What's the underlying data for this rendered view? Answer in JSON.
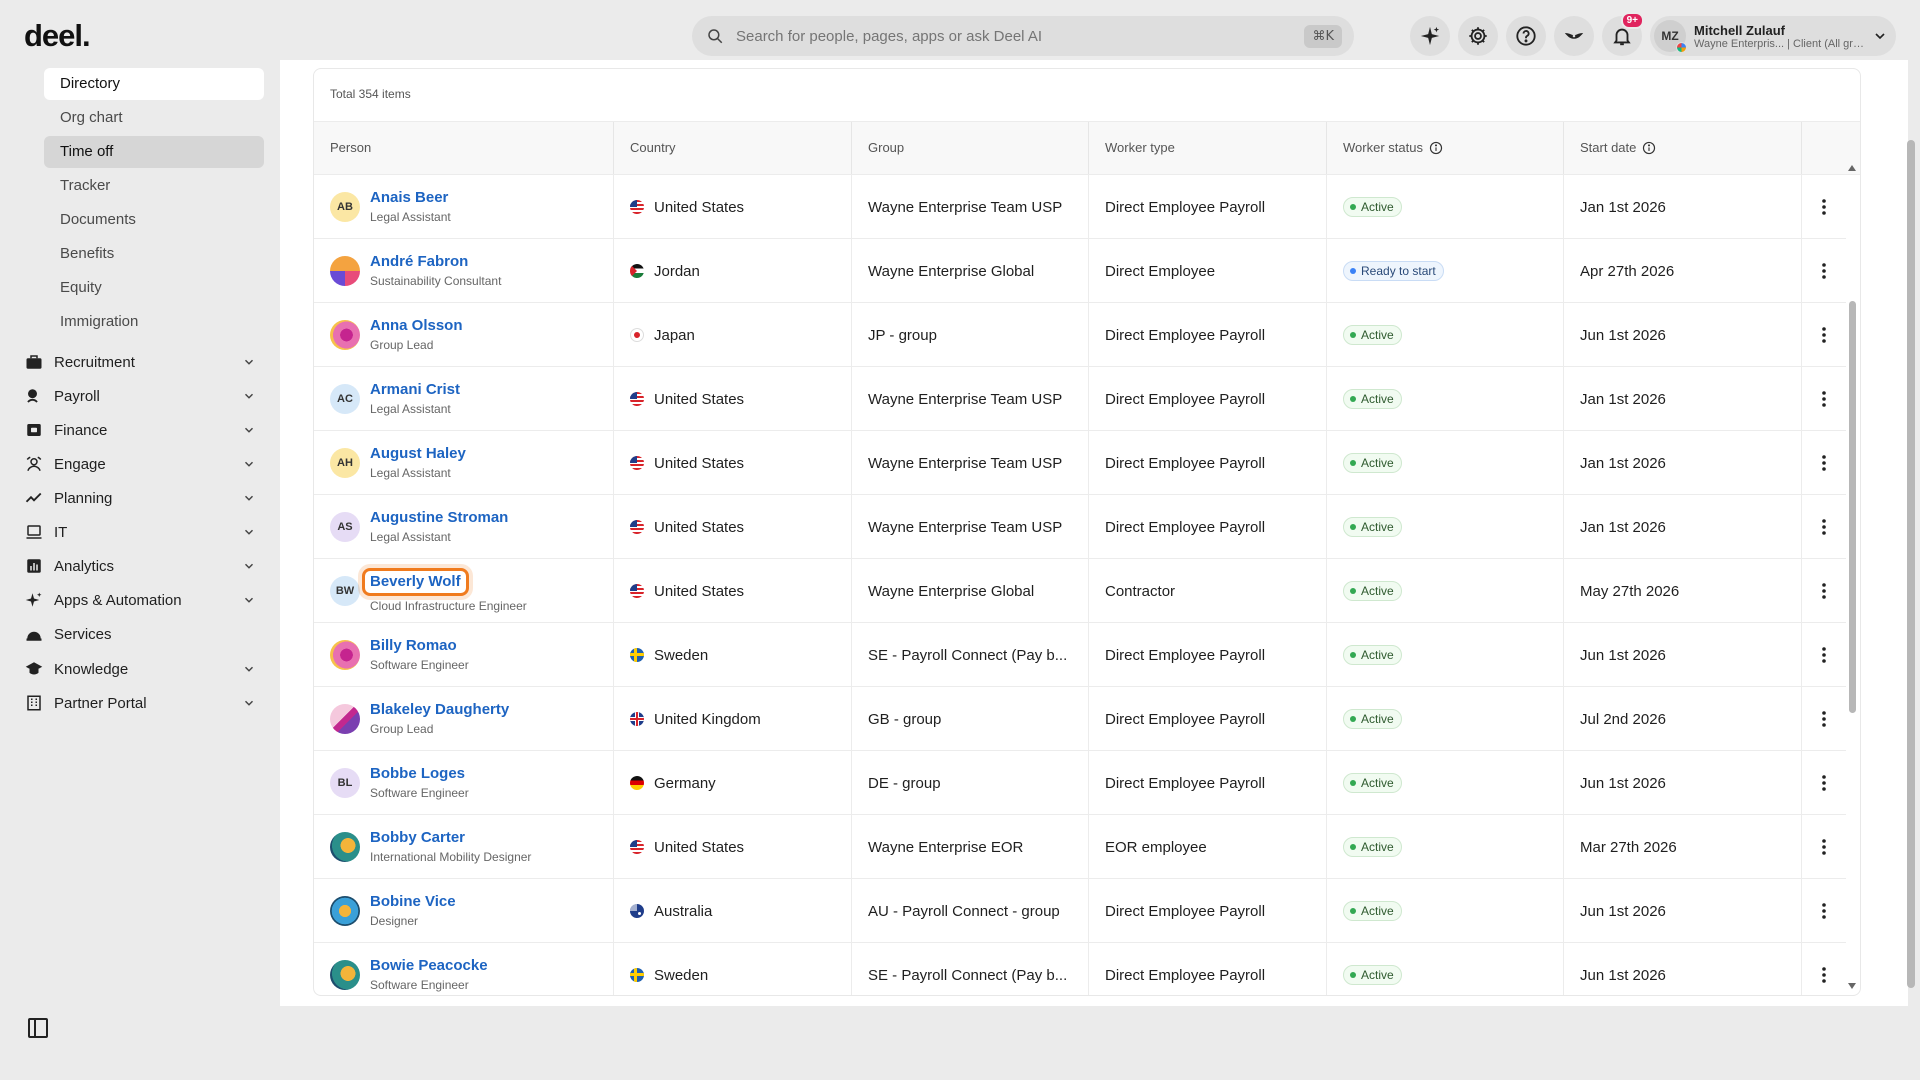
{
  "header": {
    "logo": "deel.",
    "search_placeholder": "Search for people, pages, apps or ask Deel AI",
    "search_shortcut": "⌘K",
    "notification_count": "9+",
    "user": {
      "initials": "MZ",
      "name": "Mitchell Zulauf",
      "subtitle": "Wayne Enterpris... | Client (All gro..."
    }
  },
  "sidebar": {
    "sub_items": [
      "Directory",
      "Org chart",
      "Time off",
      "Tracker",
      "Documents",
      "Benefits",
      "Equity",
      "Immigration"
    ],
    "nav_items": [
      {
        "label": "Recruitment",
        "icon": "briefcase-icon",
        "chevron": true
      },
      {
        "label": "Payroll",
        "icon": "payroll-icon",
        "chevron": true
      },
      {
        "label": "Finance",
        "icon": "finance-icon",
        "chevron": true
      },
      {
        "label": "Engage",
        "icon": "engage-icon",
        "chevron": true
      },
      {
        "label": "Planning",
        "icon": "trend-icon",
        "chevron": true
      },
      {
        "label": "IT",
        "icon": "laptop-icon",
        "chevron": true
      },
      {
        "label": "Analytics",
        "icon": "chart-icon",
        "chevron": true
      },
      {
        "label": "Apps & Automation",
        "icon": "sparkle-icon",
        "chevron": true
      },
      {
        "label": "Services",
        "icon": "services-icon",
        "chevron": false
      },
      {
        "label": "Knowledge",
        "icon": "graduation-icon",
        "chevron": true
      },
      {
        "label": "Partner Portal",
        "icon": "building-icon",
        "chevron": true
      }
    ]
  },
  "table": {
    "total": "Total 354 items",
    "columns": [
      "Person",
      "Country",
      "Group",
      "Worker type",
      "Worker status",
      "Start date"
    ],
    "rows": [
      {
        "name": "Anais Beer",
        "title": "Legal Assistant",
        "initials": "AB",
        "avatar": "#fbe7a4",
        "country": "United States",
        "flag": "us",
        "group": "Wayne Enterprise Team USP",
        "worker_type": "Direct Employee Payroll",
        "status": "Active",
        "start": "Jan 1st 2026"
      },
      {
        "name": "André Fabron",
        "title": "Sustainability Consultant",
        "initials": "",
        "avatar": "art1",
        "country": "Jordan",
        "flag": "jo",
        "group": "Wayne Enterprise Global",
        "worker_type": "Direct Employee",
        "status": "Ready to start",
        "start": "Apr 27th 2026"
      },
      {
        "name": "Anna Olsson",
        "title": "Group Lead",
        "initials": "",
        "avatar": "art2",
        "country": "Japan",
        "flag": "jp",
        "group": "JP - group",
        "worker_type": "Direct Employee Payroll",
        "status": "Active",
        "start": "Jun 1st 2026"
      },
      {
        "name": "Armani Crist",
        "title": "Legal Assistant",
        "initials": "AC",
        "avatar": "#d6e8f8",
        "country": "United States",
        "flag": "us",
        "group": "Wayne Enterprise Team USP",
        "worker_type": "Direct Employee Payroll",
        "status": "Active",
        "start": "Jan 1st 2026"
      },
      {
        "name": "August Haley",
        "title": "Legal Assistant",
        "initials": "AH",
        "avatar": "#fbe7a4",
        "country": "United States",
        "flag": "us",
        "group": "Wayne Enterprise Team USP",
        "worker_type": "Direct Employee Payroll",
        "status": "Active",
        "start": "Jan 1st 2026"
      },
      {
        "name": "Augustine Stroman",
        "title": "Legal Assistant",
        "initials": "AS",
        "avatar": "#e6dcf5",
        "country": "United States",
        "flag": "us",
        "group": "Wayne Enterprise Team USP",
        "worker_type": "Direct Employee Payroll",
        "status": "Active",
        "start": "Jan 1st 2026"
      },
      {
        "name": "Beverly Wolf",
        "title": "Cloud Infrastructure Engineer",
        "initials": "BW",
        "avatar": "#d6e8f8",
        "country": "United States",
        "flag": "us",
        "group": "Wayne Enterprise Global",
        "worker_type": "Contractor",
        "status": "Active",
        "start": "May 27th 2026",
        "focused": true
      },
      {
        "name": "Billy Romao",
        "title": "Software Engineer",
        "initials": "",
        "avatar": "art2",
        "country": "Sweden",
        "flag": "se",
        "group": "SE - Payroll Connect (Pay b...",
        "worker_type": "Direct Employee Payroll",
        "status": "Active",
        "start": "Jun 1st 2026"
      },
      {
        "name": "Blakeley Daugherty",
        "title": "Group Lead",
        "initials": "",
        "avatar": "art3",
        "country": "United Kingdom",
        "flag": "gb",
        "group": "GB - group",
        "worker_type": "Direct Employee Payroll",
        "status": "Active",
        "start": "Jul 2nd 2026"
      },
      {
        "name": "Bobbe Loges",
        "title": "Software Engineer",
        "initials": "BL",
        "avatar": "#e6dcf5",
        "country": "Germany",
        "flag": "de",
        "group": "DE - group",
        "worker_type": "Direct Employee Payroll",
        "status": "Active",
        "start": "Jun 1st 2026"
      },
      {
        "name": "Bobby Carter",
        "title": "International Mobility Designer",
        "initials": "",
        "avatar": "art4",
        "country": "United States",
        "flag": "us",
        "group": "Wayne Enterprise EOR",
        "worker_type": "EOR employee",
        "status": "Active",
        "start": "Mar 27th 2026"
      },
      {
        "name": "Bobine Vice",
        "title": "Designer",
        "initials": "",
        "avatar": "art5",
        "country": "Australia",
        "flag": "au",
        "group": "AU - Payroll Connect - group",
        "worker_type": "Direct Employee Payroll",
        "status": "Active",
        "start": "Jun 1st 2026"
      },
      {
        "name": "Bowie Peacocke",
        "title": "Software Engineer",
        "initials": "",
        "avatar": "art4",
        "country": "Sweden",
        "flag": "se",
        "group": "SE - Payroll Connect (Pay b...",
        "worker_type": "Direct Employee Payroll",
        "status": "Active",
        "start": "Jun 1st 2026"
      }
    ]
  }
}
